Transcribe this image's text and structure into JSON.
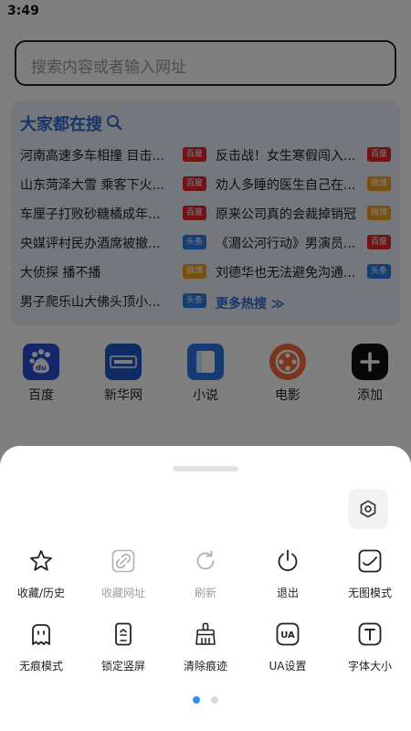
{
  "status_bar": {
    "time": "3:49"
  },
  "search": {
    "placeholder": "搜索内容或者输入网址"
  },
  "hot_search": {
    "title": "大家都在搜",
    "more_label": "更多热搜 ≫",
    "items_left": [
      {
        "text": "河南高速多车相撞 目击...",
        "badge": "百度"
      },
      {
        "text": "山东菏泽大雪 乘客下火...",
        "badge": "百度"
      },
      {
        "text": "车厘子打败砂糖橘成年...",
        "badge": "百度"
      },
      {
        "text": "央媒评村民办酒席被撤...",
        "badge": "头条"
      },
      {
        "text": "大侦探 播不播",
        "badge": "微博"
      },
      {
        "text": "男子爬乐山大佛头顶小...",
        "badge": "头条"
      }
    ],
    "items_right": [
      {
        "text": "反击战！女生寒假闯入...",
        "badge": "百度"
      },
      {
        "text": "劝人多睡的医生自己在...",
        "badge": "微博"
      },
      {
        "text": "原来公司真的会裁掉销冠",
        "badge": "微博"
      },
      {
        "text": "《湄公河行动》男演员...",
        "badge": "百度"
      },
      {
        "text": "刘德华也无法避免沟通...",
        "badge": "头条"
      }
    ],
    "badge_colors": {
      "百度": "#e5262a",
      "头条": "#2f7bea",
      "微博": "#f0a020"
    }
  },
  "shortcuts": [
    {
      "label": "百度",
      "icon": "baidu-icon",
      "color": "#2b4cd6"
    },
    {
      "label": "新华网",
      "icon": "xinhua-icon",
      "color": "#1f57c8"
    },
    {
      "label": "小说",
      "icon": "book-icon",
      "color": "#2a74e8"
    },
    {
      "label": "电影",
      "icon": "film-reel-icon",
      "color": "#f26b3a"
    },
    {
      "label": "添加",
      "icon": "plus-icon",
      "color": "#111111"
    }
  ],
  "menu": {
    "row1": [
      {
        "label": "收藏/历史",
        "icon": "star-icon",
        "enabled": true
      },
      {
        "label": "收藏网址",
        "icon": "link-icon",
        "enabled": false
      },
      {
        "label": "刷新",
        "icon": "refresh-icon",
        "enabled": false
      },
      {
        "label": "退出",
        "icon": "power-icon",
        "enabled": true
      },
      {
        "label": "无图模式",
        "icon": "no-image-icon",
        "enabled": true
      }
    ],
    "row2": [
      {
        "label": "无痕模式",
        "icon": "ghost-icon",
        "enabled": true
      },
      {
        "label": "锁定竖屏",
        "icon": "portrait-lock-icon",
        "enabled": true
      },
      {
        "label": "清除痕迹",
        "icon": "broom-icon",
        "enabled": true
      },
      {
        "label": "UA设置",
        "icon": "ua-icon",
        "enabled": true
      },
      {
        "label": "字体大小",
        "icon": "font-size-icon",
        "enabled": true
      }
    ]
  },
  "pagination": {
    "active_color": "#2f8ff0",
    "inactive_color": "#d8d8d8"
  }
}
